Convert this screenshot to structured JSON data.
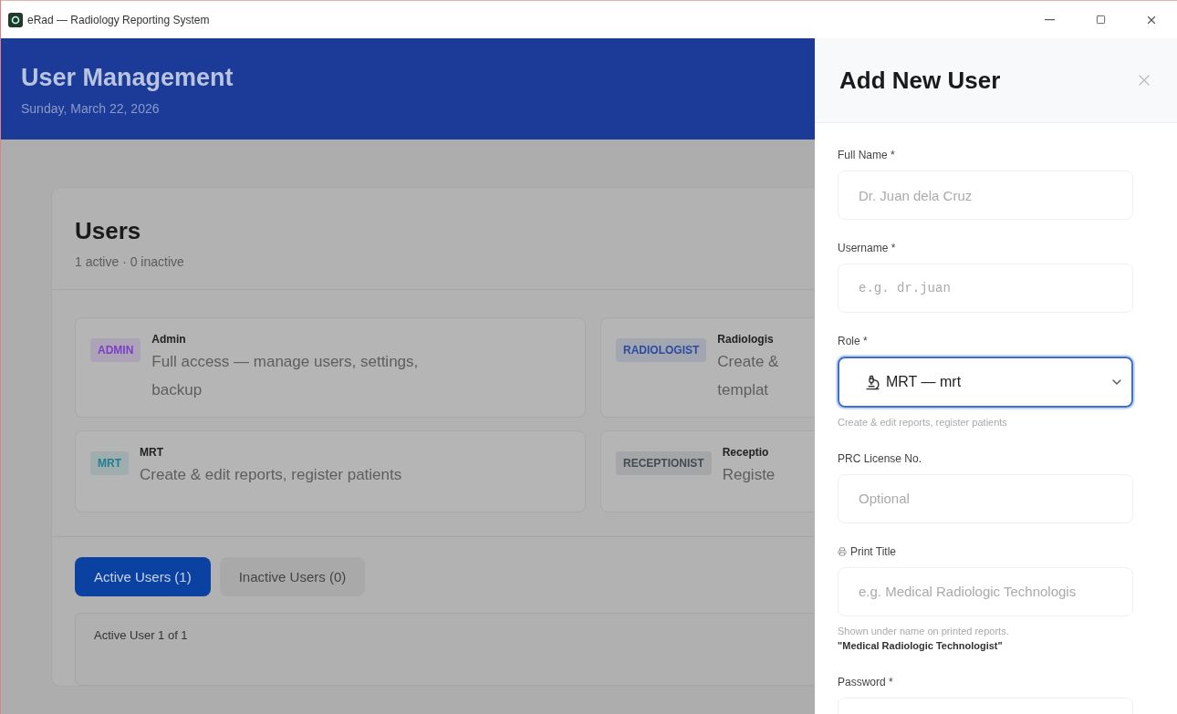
{
  "window": {
    "title": "eRad — Radiology Reporting System"
  },
  "header": {
    "title": "User Management",
    "date": "Sunday, March 22, 2026"
  },
  "users": {
    "title": "Users",
    "summary": "1 active · 0 inactive"
  },
  "roles": [
    {
      "badge": "ADMIN",
      "color": "#7b3fc4",
      "name": "Admin",
      "description_lines": [
        "Full access — manage users, settings,",
        "backup"
      ]
    },
    {
      "badge": "RADIOLOGIST",
      "color": "#2d4aa0",
      "name": "Radiologis",
      "description_lines": [
        "Create &",
        "templat"
      ]
    },
    {
      "badge": "MRT",
      "color": "#1f7f8f",
      "name": "MRT",
      "description_lines": [
        "Create & edit reports, register patients"
      ]
    },
    {
      "badge": "RECEPTIONIST",
      "color": "#444a55",
      "name": "Receptio",
      "description_lines": [
        "Registe"
      ]
    }
  ],
  "tabs": [
    {
      "label": "Active Users (1)",
      "selected": true
    },
    {
      "label": "Inactive Users (0)",
      "selected": false
    }
  ],
  "list_caption": "Active User 1 of 1",
  "panel": {
    "title": "Add New User",
    "fields": [
      {
        "kind": "input",
        "label": "Full Name *",
        "placeholder": "Dr. Juan dela Cruz"
      },
      {
        "kind": "input",
        "label": "Username *",
        "placeholder": "e.g. dr.juan",
        "mono": true
      },
      {
        "kind": "select",
        "label": "Role *",
        "value": "MRT — mrt",
        "help": "Create & edit reports, register patients",
        "focused": true
      },
      {
        "kind": "input",
        "label": "PRC License No.",
        "placeholder": "Optional"
      },
      {
        "kind": "input",
        "label": "Print Title",
        "icon": true,
        "placeholder": "e.g. Medical Radiologic Technologis",
        "help": "Shown under name on printed reports. **\"Medical Radiologic Technologist\"**"
      },
      {
        "kind": "input",
        "label": "Password *"
      }
    ]
  }
}
